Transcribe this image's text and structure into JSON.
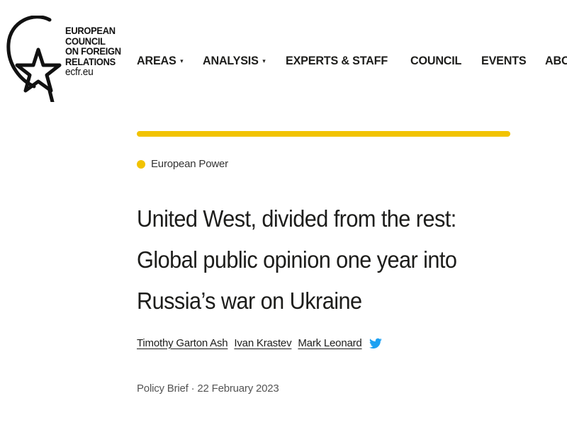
{
  "logo": {
    "lines": [
      "EUROPEAN",
      "COUNCIL",
      "ON FOREIGN",
      "RELATIONS"
    ],
    "domain": "ecfr.eu",
    "icon": "star-in-circle-logo"
  },
  "nav": {
    "items": [
      {
        "label": "AREAS",
        "has_dropdown": true
      },
      {
        "label": "ANALYSIS",
        "has_dropdown": true
      },
      {
        "label": "EXPERTS & STAFF",
        "has_dropdown": false
      },
      {
        "label": "COUNCIL",
        "has_dropdown": false
      },
      {
        "label": "EVENTS",
        "has_dropdown": false
      },
      {
        "label": "ABOUT",
        "has_dropdown": true
      }
    ],
    "caret": "▾"
  },
  "article": {
    "category": "European Power",
    "title": "United West, divided from the rest: Global public opinion one year into Russia’s war on Ukraine",
    "authors": [
      "Timothy Garton Ash",
      "Ivan Krastev",
      "Mark Leonard"
    ],
    "meta": "Policy Brief · 22 February 2023"
  },
  "colors": {
    "accent_yellow": "#f2c300",
    "twitter_blue": "#1da1f2",
    "text": "#1d1d1b"
  }
}
